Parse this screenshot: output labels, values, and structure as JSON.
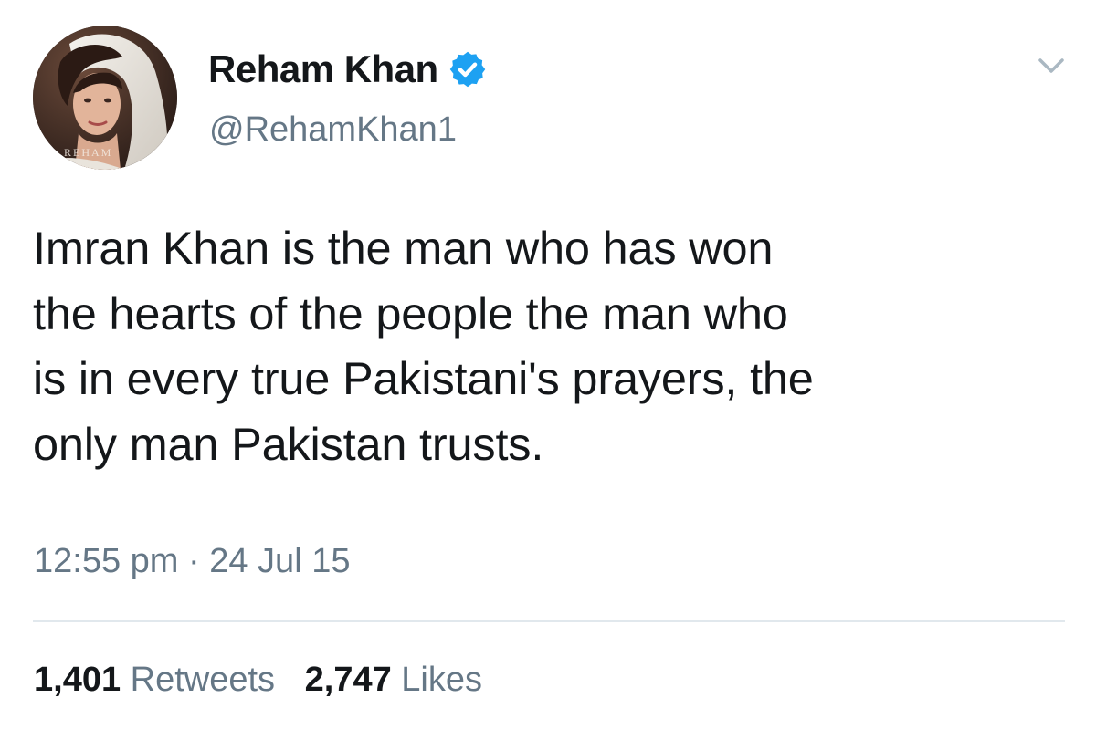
{
  "author": {
    "display_name": "Reham Khan",
    "handle": "@RehamKhan1",
    "verified": true,
    "avatar_watermark": "REHAM"
  },
  "tweet": {
    "text": "Imran Khan is the man who has won\nthe hearts of the people the man who\nis in every true Pakistani's prayers, the\nonly man Pakistan trusts.",
    "time": "12:55 pm",
    "separator": "·",
    "date": "24 Jul 15"
  },
  "stats": {
    "retweets_count": "1,401",
    "retweets_label": "Retweets",
    "likes_count": "2,747",
    "likes_label": "Likes"
  },
  "icons": {
    "verified": "verified-badge-icon",
    "menu": "chevron-down-icon"
  },
  "colors": {
    "verified_blue": "#1da1f2",
    "muted_text": "#657786",
    "primary_text": "#14171a",
    "divider": "#e1e8ed"
  }
}
